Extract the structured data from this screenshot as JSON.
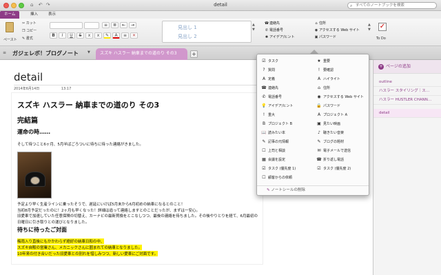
{
  "window": {
    "title": "detail",
    "search_placeholder": "すべてのノートブックを検索"
  },
  "ribbon_tabs": [
    "ホーム",
    "挿入",
    "表示"
  ],
  "ribbon": {
    "paste_label": "ペースト",
    "cut_label": "カット",
    "copy_label": "コピー",
    "format_label": "書式",
    "style_h1": "見出し 1",
    "style_h2": "見出し 2",
    "tags_left": [
      "連絡先",
      "電話番号",
      "アイデア/ヒント"
    ],
    "tags_right": [
      "住所",
      "アクセスする Web サイト",
      "パスワード"
    ],
    "todo_label": "To Do"
  },
  "notebook": {
    "name": "ガジェレボ！ブログノート",
    "section": "スズキ ハスラー 納車までの道のり その3",
    "add_section": "+"
  },
  "page": {
    "title": "detail",
    "date": "2014年6月14日",
    "time": "13:17",
    "heading": "スズキ ハスラー 納車までの道のり その3",
    "subheading": "完結篇",
    "section1": "運命の時……",
    "line1": "そして待つこと6ヶ月、5月半ばごろついに待ちに待った連絡がきました。",
    "para": [
      "予定より早く生産ラインに乗ったそうで、遅延にいけば5月末から6月初めの納車になるとのこと！",
      "当初8月予定だったのに！2ヶ月も早くなった！詳細は追って連絡しますとのことだったが、まずは一安心。",
      "旧愛車で加速していた任意保険の切替え、カーナビの最新買換をとこなしつつ、最後の連絡を待ちました。その後やりとりを経て、6月最初の日曜日に引き取りとの運びとなりました。"
    ],
    "section2": "待ちに待ったご対面",
    "highlight": [
      "梅雨入り直後にもかかわらず絶好の納車日和の中、",
      "スズキ自販の営業さん、メカニックさんに囲まれての納車となりました。",
      "10年来の付き合いだった旧愛車との別れを惜しみつつ、新しい愛車にご対面です。"
    ]
  },
  "pages_pane": {
    "add_label": "ページの追加",
    "items": [
      "outline",
      "ハスラー スタイリング｜ス…",
      "ハスラー HUSTLER CHANN…",
      "detail"
    ],
    "selected": "detail"
  },
  "tags_popup": {
    "items_left": [
      {
        "icon": "☑",
        "label": "タスク"
      },
      {
        "icon": "?",
        "label": "質問"
      },
      {
        "icon": "A",
        "label": "定義"
      },
      {
        "icon": "☎",
        "label": "連絡先"
      },
      {
        "icon": "✆",
        "label": "電話番号"
      },
      {
        "icon": "💡",
        "label": "アイデア/ヒント"
      },
      {
        "icon": "!",
        "label": "重大"
      },
      {
        "icon": "B",
        "label": "プロジェクト B"
      },
      {
        "icon": "📖",
        "label": "読みたい本"
      },
      {
        "icon": "✎",
        "label": "記事の元情報"
      },
      {
        "icon": "☐",
        "label": "上司と相談"
      },
      {
        "icon": "▦",
        "label": "会議を設定"
      },
      {
        "icon": "☑",
        "label": "タスク (優先度 1)"
      },
      {
        "icon": "☐",
        "label": "顧客からの依頼"
      }
    ],
    "items_right": [
      {
        "icon": "★",
        "label": "重要"
      },
      {
        "icon": "!",
        "label": "要確認"
      },
      {
        "icon": "A",
        "label": "ハイライト"
      },
      {
        "icon": "⌂",
        "label": "住所"
      },
      {
        "icon": "◉",
        "label": "アクセスする Web サイト"
      },
      {
        "icon": "🔒",
        "label": "パスワード"
      },
      {
        "icon": "A",
        "label": "プロジェクト A"
      },
      {
        "icon": "▣",
        "label": "見たい映画"
      },
      {
        "icon": "♪",
        "label": "聴きたい音楽"
      },
      {
        "icon": "✎",
        "label": "ブログの題材"
      },
      {
        "icon": "✉",
        "label": "電子メールで送信"
      },
      {
        "icon": "☎",
        "label": "折り返し電話"
      },
      {
        "icon": "☑",
        "label": "タスク (優先度 2)"
      }
    ],
    "footer": "ノートシールの削除"
  }
}
